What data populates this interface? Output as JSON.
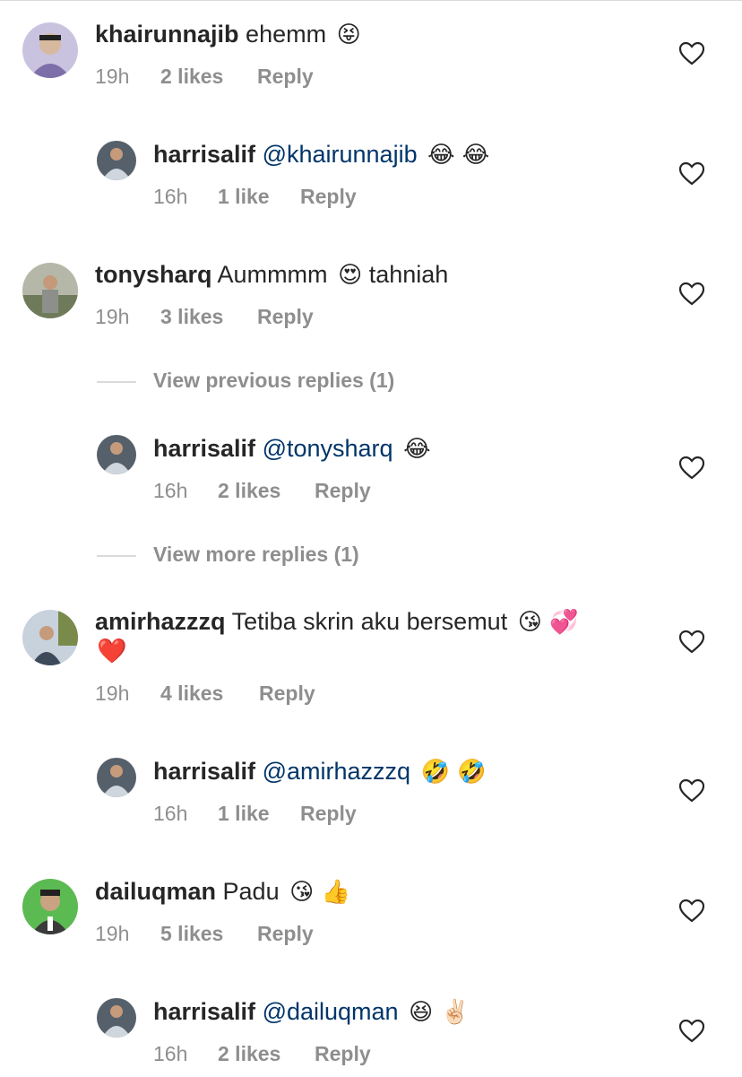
{
  "comments": [
    {
      "username": "khairunnajib",
      "text": "ehemm",
      "emojis": "😝",
      "time": "19h",
      "likes": "2 likes",
      "reply_label": "Reply",
      "avatar_color": "#7d6fa8",
      "reply": {
        "username": "harrisalif",
        "mention": "@khairunnajib",
        "emojis": "😂 😂",
        "time": "16h",
        "likes": "1 like",
        "reply_label": "Reply",
        "avatar_color": "#3b3f45"
      }
    },
    {
      "username": "tonysharq",
      "text": "Aummmm",
      "emojis": "😍",
      "text2": "tahniah",
      "time": "19h",
      "likes": "3 likes",
      "reply_label": "Reply",
      "avatar_color": "#8a8f82",
      "view_previous": "View previous replies (1)",
      "reply": {
        "username": "harrisalif",
        "mention": "@tonysharq",
        "emojis": "😂",
        "time": "16h",
        "likes": "2 likes",
        "reply_label": "Reply",
        "avatar_color": "#3b3f45"
      },
      "view_more": "View more replies (1)"
    },
    {
      "username": "amirhazzzq",
      "text": "Tetiba skrin aku bersemut",
      "emojis": "😘 💞",
      "emojis_line2": "❤️",
      "time": "19h",
      "likes": "4 likes",
      "reply_label": "Reply",
      "avatar_color": "#9aa7b8",
      "reply": {
        "username": "harrisalif",
        "mention": "@amirhazzzq",
        "emojis": "🤣 🤣",
        "time": "16h",
        "likes": "1 like",
        "reply_label": "Reply",
        "avatar_color": "#3b3f45"
      }
    },
    {
      "username": "dailuqman",
      "text": "Padu",
      "emojis": "😘 👍",
      "time": "19h",
      "likes": "5 likes",
      "reply_label": "Reply",
      "avatar_color": "#4fae4a",
      "reply": {
        "username": "harrisalif",
        "mention": "@dailuqman",
        "emojis": "😆 ✌🏻",
        "time": "16h",
        "likes": "2 likes",
        "reply_label": "Reply",
        "avatar_color": "#3b3f45"
      }
    }
  ],
  "icons": {
    "like": "heart-outline-icon"
  },
  "colors": {
    "mention": "#003569",
    "meta": "#8e8e8e",
    "text": "#262626"
  }
}
